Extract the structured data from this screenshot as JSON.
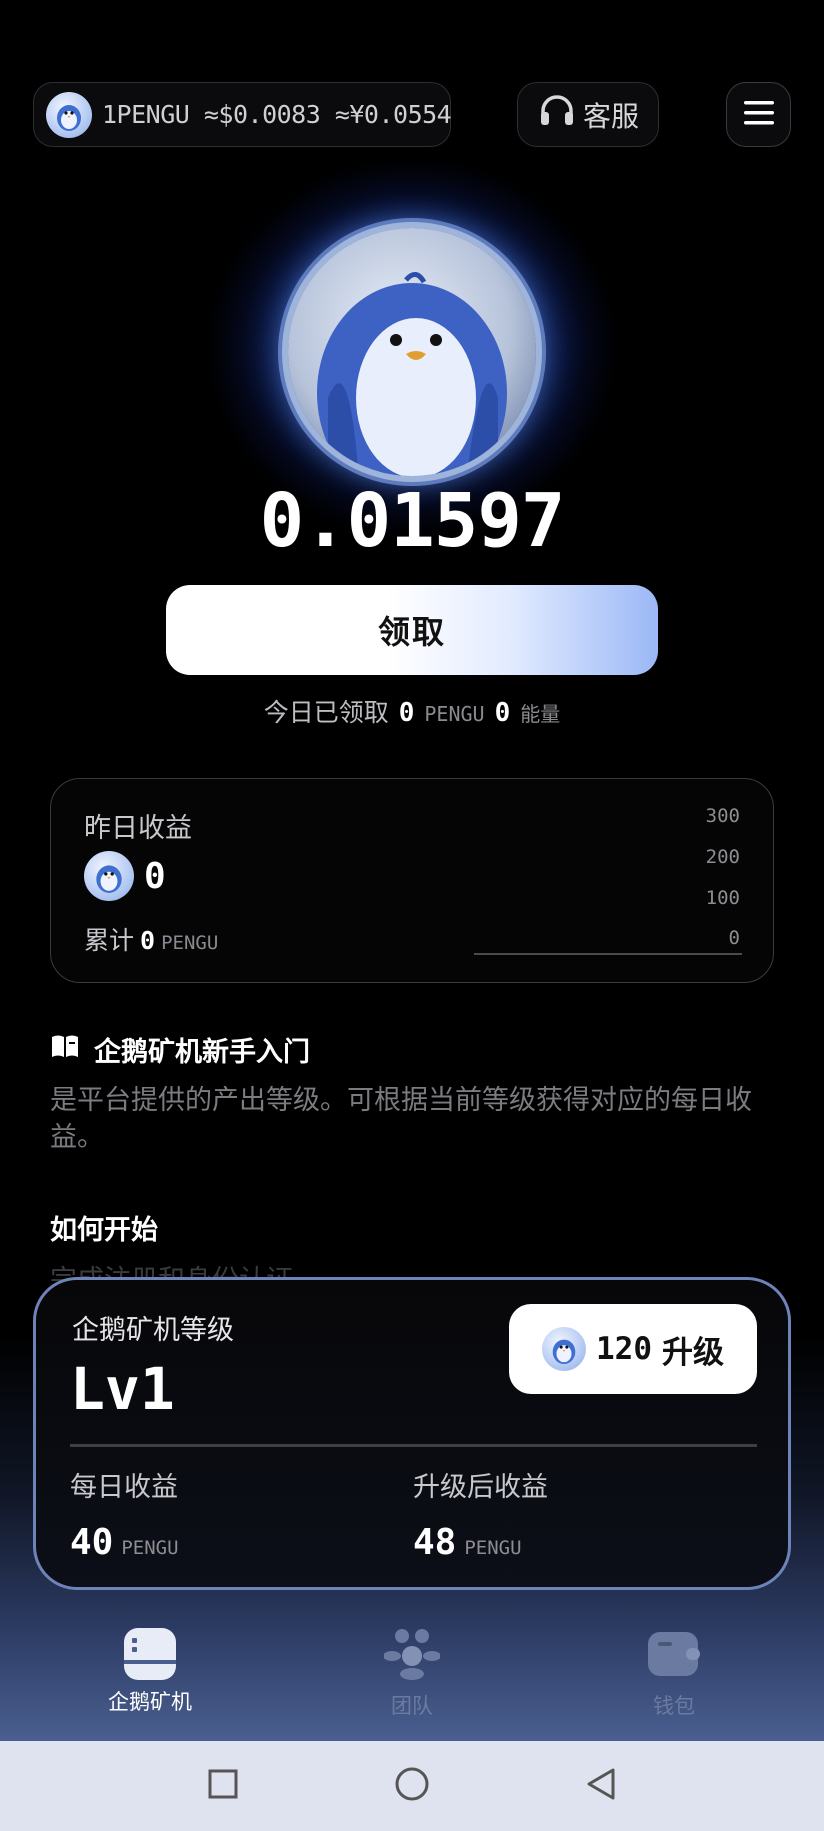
{
  "header": {
    "price_text": "1PENGU ≈$0.0083 ≈¥0.0554",
    "support_label": "客服",
    "icons": [
      "pengu-coin-icon",
      "headset-icon",
      "menu-icon"
    ]
  },
  "hero": {
    "balance": "0.01597",
    "claim_label": "领取",
    "today": {
      "prefix": "今日已领取",
      "pengu_value": "0",
      "pengu_unit": "PENGU",
      "energy_value": "0",
      "energy_unit": "能量"
    }
  },
  "yesterday": {
    "title": "昨日收益",
    "value": "0",
    "total_label": "累计",
    "total_value": "0",
    "total_unit": "PENGU",
    "axis_ticks": [
      "300",
      "200",
      "100",
      "0"
    ]
  },
  "guide": {
    "title": "企鹅矿机新手入门",
    "description": "是平台提供的产出等级。可根据当前等级获得对应的每日收益。",
    "how_title": "如何开始",
    "how_text": "完成注册和身份认证。"
  },
  "level_card": {
    "label": "企鹅矿机等级",
    "level": "Lv1",
    "upgrade_cost": "120",
    "upgrade_label": "升级",
    "daily_label": "每日收益",
    "daily_value": "40",
    "daily_unit": "PENGU",
    "after_label": "升级后收益",
    "after_value": "48",
    "after_unit": "PENGU"
  },
  "tabs": [
    {
      "label": "企鹅矿机",
      "active": true
    },
    {
      "label": "团队",
      "active": false
    },
    {
      "label": "钱包",
      "active": false
    }
  ],
  "colors": {
    "accent_blue": "#5e7bbd",
    "card_border": "#6e83b8",
    "inactive_tab": "#6b7aa0"
  }
}
